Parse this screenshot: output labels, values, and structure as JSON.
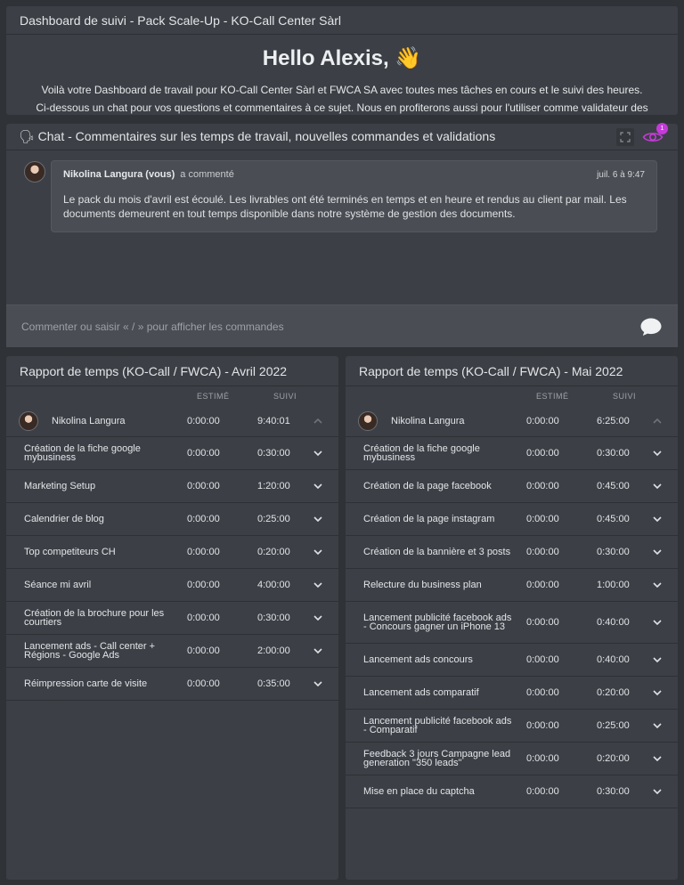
{
  "header": {
    "title": "Dashboard de suivi - Pack Scale-Up - KO-Call Center Sàrl",
    "greeting": "Hello Alexis, 👋",
    "intro_line1": "Voilà votre Dashboard de travail pour KO-Call Center Sàrl et FWCA SA avec toutes mes tâches en cours et le suivi des heures.",
    "intro_line2": "Ci-dessous un chat pour vos questions et commentaires à ce sujet. Nous en profiterons aussi pour l'utiliser comme validateur des"
  },
  "chat": {
    "title_icon": "speech-balloon-icon",
    "title": "🗣 Chat - Commentaires sur les temps de travail, nouvelles commandes et validations",
    "watch_count": "1",
    "comment": {
      "author": "Nikolina Langura (vous)",
      "action": "a commenté",
      "date": "juil. 6 à 9:47",
      "text": "Le pack du mois d'avril est écoulé. Les livrables ont été terminés en temps et en heure et rendus au client par mail. Les documents demeurent en tout temps disponible dans notre système de gestion des documents."
    },
    "input_placeholder": "Commenter ou saisir « / » pour afficher les commandes"
  },
  "reports": {
    "col_estimated": "ESTIMÉ",
    "col_tracked": "SUIVI",
    "avril": {
      "title": "Rapport de temps (KO-Call / FWCA) - Avril 2022",
      "user": {
        "name": "Nikolina Langura",
        "estimated": "0:00:00",
        "tracked": "9:40:01"
      },
      "rows": [
        {
          "name": "Création de la fiche google mybusiness",
          "estimated": "0:00:00",
          "tracked": "0:30:00"
        },
        {
          "name": "Marketing Setup",
          "estimated": "0:00:00",
          "tracked": "1:20:00"
        },
        {
          "name": "Calendrier de blog",
          "estimated": "0:00:00",
          "tracked": "0:25:00"
        },
        {
          "name": "Top competiteurs CH",
          "estimated": "0:00:00",
          "tracked": "0:20:00"
        },
        {
          "name": "Séance mi avril",
          "estimated": "0:00:00",
          "tracked": "4:00:00"
        },
        {
          "name": "Création de la brochure pour les courtiers",
          "estimated": "0:00:00",
          "tracked": "0:30:00"
        },
        {
          "name": "Lancement ads - Call center + Régions - Google Ads",
          "estimated": "0:00:00",
          "tracked": "2:00:00"
        },
        {
          "name": "Réimpression carte de visite",
          "estimated": "0:00:00",
          "tracked": "0:35:00"
        }
      ]
    },
    "mai": {
      "title": "Rapport de temps (KO-Call / FWCA) - Mai 2022",
      "user": {
        "name": "Nikolina Langura",
        "estimated": "0:00:00",
        "tracked": "6:25:00"
      },
      "rows": [
        {
          "name": "Création de la fiche google mybusiness",
          "estimated": "0:00:00",
          "tracked": "0:30:00"
        },
        {
          "name": "Création de la page facebook",
          "estimated": "0:00:00",
          "tracked": "0:45:00"
        },
        {
          "name": "Création de la page instagram",
          "estimated": "0:00:00",
          "tracked": "0:45:00"
        },
        {
          "name": "Création de la bannière et 3 posts",
          "estimated": "0:00:00",
          "tracked": "0:30:00"
        },
        {
          "name": "Relecture du business plan",
          "estimated": "0:00:00",
          "tracked": "1:00:00"
        },
        {
          "name": "Lancement publicité facebook ads - Concours gagner un iPhone 13",
          "estimated": "0:00:00",
          "tracked": "0:40:00"
        },
        {
          "name": "Lancement ads concours",
          "estimated": "0:00:00",
          "tracked": "0:40:00"
        },
        {
          "name": "Lancement ads comparatif",
          "estimated": "0:00:00",
          "tracked": "0:20:00"
        },
        {
          "name": "Lancement publicité facebook ads - Comparatif",
          "estimated": "0:00:00",
          "tracked": "0:25:00"
        },
        {
          "name": "Feedback 3 jours Campagne lead generation \"350 leads\"",
          "estimated": "0:00:00",
          "tracked": "0:20:00"
        },
        {
          "name": "Mise en place du captcha",
          "estimated": "0:00:00",
          "tracked": "0:30:00"
        }
      ]
    }
  },
  "colors": {
    "accent_badge": "#c53ad8",
    "panel": "#3c4046",
    "background": "#2f3338"
  }
}
